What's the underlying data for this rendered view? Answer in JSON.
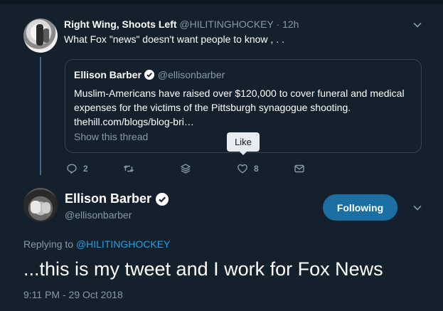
{
  "parent_tweet": {
    "name": "Right Wing, Shoots Left",
    "handle": "@HILITINGHOCKEY",
    "separator": " · ",
    "time": "12h",
    "text": "What Fox \"news\" doesn't want people to know , . ."
  },
  "quoted_tweet": {
    "name": "Ellison Barber",
    "handle": "@ellisonbarber",
    "text": "Muslim-Americans have raised over $120,000 to cover funeral and medical expenses for the victims of the Pittsburgh synagogue shooting.",
    "link": "thehill.com/blogs/blog-bri…",
    "show_thread": "Show this thread"
  },
  "tooltip": {
    "label": "Like"
  },
  "actions": {
    "reply_count": "2",
    "retweet_count": "",
    "like_count": "8"
  },
  "main_tweet": {
    "name": "Ellison Barber",
    "handle": "@ellisonbarber",
    "follow_label": "Following",
    "replying_prefix": "Replying to ",
    "replying_handle": "@HILITINGHOCKEY",
    "text": "...this is my tweet and I work for Fox News",
    "timestamp": "9:11 PM - 29 Oct 2018"
  },
  "icons": {
    "reply": "reply-icon",
    "retweet": "retweet-icon",
    "save": "layers-icon",
    "like": "heart-icon",
    "dm": "envelope-icon",
    "verified": "verified-badge-icon",
    "more": "chevron-down-icon"
  },
  "colors": {
    "background": "#14202c",
    "accent": "#1da1f2",
    "follow_button": "#1b6fa3",
    "muted": "#8899a6",
    "border": "#38444d"
  }
}
